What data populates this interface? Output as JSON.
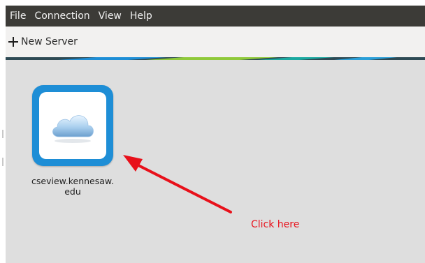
{
  "menubar": {
    "items": [
      {
        "label": "File"
      },
      {
        "label": "Connection"
      },
      {
        "label": "View"
      },
      {
        "label": "Help"
      }
    ]
  },
  "toolbar": {
    "new_server_label": "New Server",
    "new_server_icon": "plus-icon"
  },
  "servers": [
    {
      "name": "cseview.kennesaw.edu",
      "icon": "cloud-icon",
      "tile_color": "#1e8ed6"
    }
  ],
  "annotation": {
    "text": "Click here",
    "color": "#e8101a"
  },
  "colors": {
    "menubar_bg": "#3c3b37",
    "toolbar_bg": "#f2f1f0",
    "content_bg": "#dedede"
  }
}
